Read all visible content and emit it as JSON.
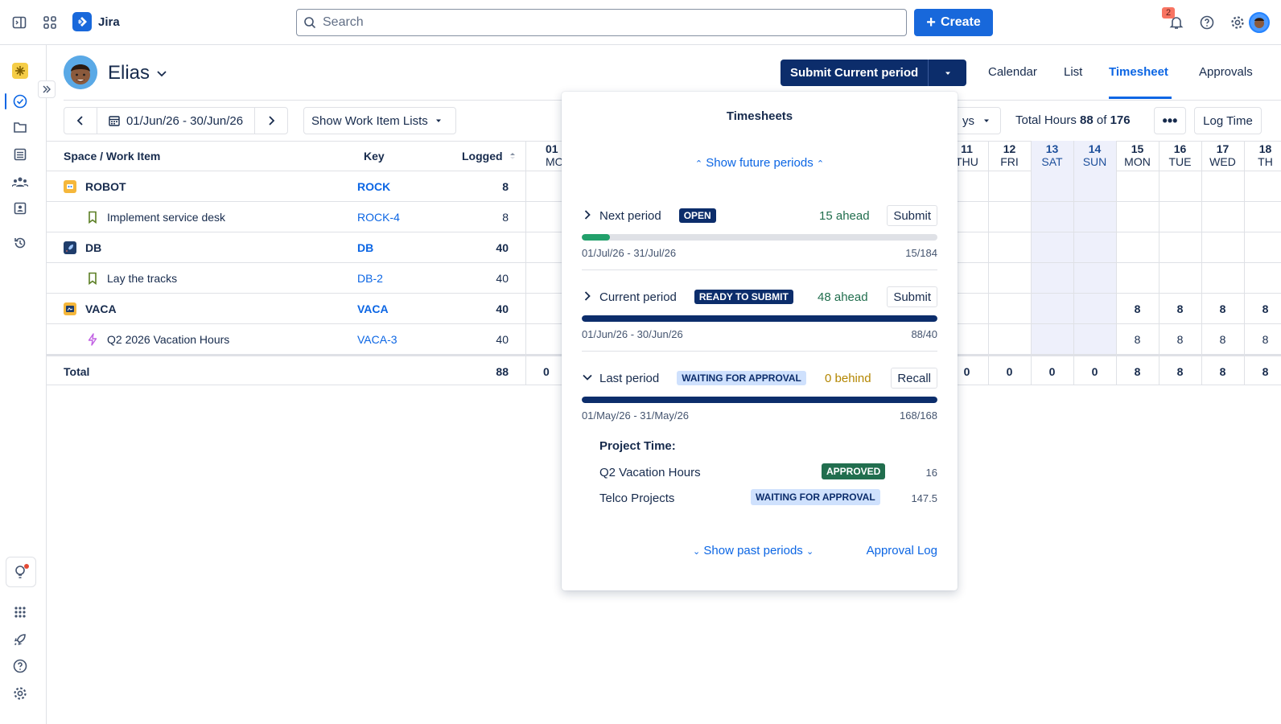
{
  "topbar": {
    "app_name": "Jira",
    "search_placeholder": "Search",
    "create_label": "Create",
    "notifications_count": "2"
  },
  "header": {
    "user_name": "Elias",
    "submit_label": "Submit Current period",
    "tabs": [
      {
        "label": "Calendar"
      },
      {
        "label": "List"
      },
      {
        "label": "Timesheet"
      },
      {
        "label": "Approvals"
      }
    ]
  },
  "toolbar": {
    "date_range": "01/Jun/26 - 30/Jun/26",
    "show_lists": "Show Work Item Lists",
    "days_partial": "ys",
    "total_hours_prefix": "Total Hours ",
    "total_logged": "88",
    "total_of": " of ",
    "total_capacity": "176",
    "more_label": "•••",
    "log_time": "Log Time"
  },
  "grid": {
    "headers": {
      "item": "Space / Work Item",
      "key": "Key",
      "logged": "Logged"
    },
    "first_day": {
      "num": "01",
      "dow": "MO"
    },
    "days": [
      {
        "num": "11",
        "dow": "THU",
        "weekend": false
      },
      {
        "num": "12",
        "dow": "FRI",
        "weekend": false
      },
      {
        "num": "13",
        "dow": "SAT",
        "weekend": true
      },
      {
        "num": "14",
        "dow": "SUN",
        "weekend": true
      },
      {
        "num": "15",
        "dow": "MON",
        "weekend": false
      },
      {
        "num": "16",
        "dow": "TUE",
        "weekend": false
      },
      {
        "num": "17",
        "dow": "WED",
        "weekend": false
      },
      {
        "num": "18",
        "dow": "TH",
        "weekend": false
      }
    ],
    "rows": [
      {
        "name": "ROBOT",
        "key": "ROCK",
        "logged": "8",
        "level": "space",
        "icon": "robot-project-icon",
        "days": [
          "",
          "",
          "",
          "",
          "",
          "",
          "",
          ""
        ]
      },
      {
        "name": "Implement service desk",
        "key": "ROCK-4",
        "logged": "8",
        "level": "item",
        "icon": "bookmark-icon",
        "days": [
          "",
          "",
          "",
          "",
          "",
          "",
          "",
          ""
        ]
      },
      {
        "name": "DB",
        "key": "DB",
        "logged": "40",
        "level": "space",
        "icon": "rocket-project-icon",
        "days": [
          "",
          "",
          "",
          "",
          "",
          "",
          "",
          ""
        ]
      },
      {
        "name": "Lay the tracks",
        "key": "DB-2",
        "logged": "40",
        "level": "item",
        "icon": "bookmark-icon",
        "days": [
          "",
          "",
          "",
          "",
          "",
          "",
          "",
          ""
        ]
      },
      {
        "name": "VACA",
        "key": "VACA",
        "logged": "40",
        "level": "space",
        "icon": "vacation-project-icon",
        "days": [
          "",
          "",
          "",
          "",
          "8",
          "8",
          "8",
          "8"
        ]
      },
      {
        "name": "Q2 2026 Vacation Hours",
        "key": "VACA-3",
        "logged": "40",
        "level": "item",
        "icon": "lightning-icon",
        "days": [
          "",
          "",
          "",
          "",
          "8",
          "8",
          "8",
          "8"
        ]
      }
    ],
    "total": {
      "label": "Total",
      "logged": "88",
      "first_day": "0",
      "days": [
        "0",
        "0",
        "0",
        "0",
        "8",
        "8",
        "8",
        "8"
      ]
    }
  },
  "popover": {
    "title": "Timesheets",
    "future_link": "Show future periods",
    "periods": [
      {
        "name": "Next period",
        "status": "OPEN",
        "ahead": "15 ahead",
        "action": "Submit",
        "dates": "01/Jul/26 - 31/Jul/26",
        "count": "15/184",
        "progress": 0.08,
        "bar_color": "#22a06b",
        "ahead_color": "#216e4e"
      },
      {
        "name": "Current period",
        "status": "READY TO SUBMIT",
        "ahead": "48 ahead",
        "action": "Submit",
        "dates": "01/Jun/26 - 30/Jun/26",
        "count": "88/40",
        "progress": 1.0,
        "bar_color": "#0c2d6b",
        "ahead_color": "#216e4e"
      },
      {
        "name": "Last period",
        "status": "WAITING FOR APPROVAL",
        "ahead": "0 behind",
        "action": "Recall",
        "dates": "01/May/26 - 31/May/26",
        "count": "168/168",
        "progress": 1.0,
        "bar_color": "#0c2d6b",
        "ahead_color": "#b38600"
      }
    ],
    "project_time_title": "Project Time:",
    "project_time": [
      {
        "name": "Q2 Vacation Hours",
        "status": "APPROVED",
        "value": "16"
      },
      {
        "name": "Telco Projects",
        "status": "WAITING FOR APPROVAL",
        "value": "147.5"
      }
    ],
    "past_link": "Show past periods",
    "approval_log": "Approval Log"
  }
}
